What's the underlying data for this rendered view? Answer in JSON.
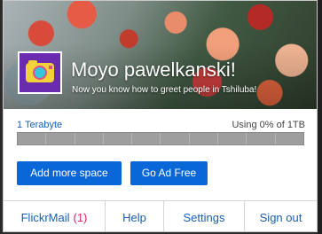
{
  "header": {
    "title": "Moyo pawelkanski!",
    "subtitle": "Now you know how to greet people in Tshiluba!",
    "avatar_icon": "camera-icon"
  },
  "storage": {
    "plan_label": "1 Terabyte",
    "usage_text": "Using 0% of 1TB",
    "usage_fraction": 0.0
  },
  "buttons": {
    "add_space": "Add more space",
    "ad_free": "Go Ad Free"
  },
  "footer": {
    "mail_label": "FlickrMail",
    "mail_count": "(1)",
    "help_label": "Help",
    "settings_label": "Settings",
    "signout_label": "Sign out"
  },
  "colors": {
    "accent": "#0a67d8",
    "link": "#1a5fb4",
    "badge": "#d6246e"
  }
}
